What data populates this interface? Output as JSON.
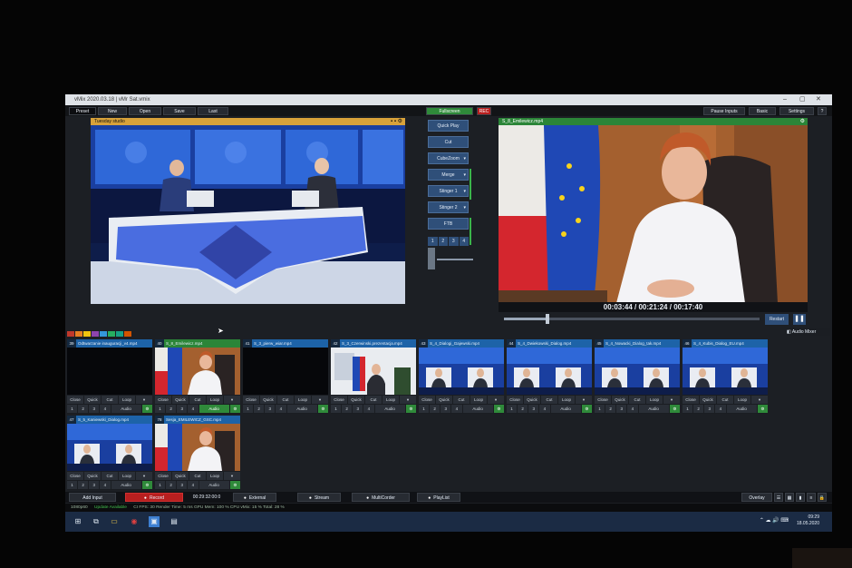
{
  "window": {
    "title": "vMix   2020.03.18 | vMr   Sat.vmix",
    "minimize": "–",
    "maximize": "▢",
    "close": "✕"
  },
  "menu": {
    "preset": "Preset",
    "new": "New",
    "open": "Open",
    "save": "Save",
    "last": "Last",
    "fullscreen": "Fullscreen",
    "rec": "REC",
    "pause_inputs": "Pause Inputs",
    "basic": "Basic",
    "settings": "Settings",
    "help": "?"
  },
  "preview": {
    "header": "Tuesday studio"
  },
  "program": {
    "header": "S_8_Emilewicz.mp4",
    "time_position": "00:03:44",
    "time_duration": "00:21:24",
    "time_remaining": "00:17:40",
    "progress": 0.17
  },
  "transitions": {
    "quick_play": "Quick Play",
    "cut": "Cut",
    "cube_zoom": "CubeZoom",
    "merge": "Merge",
    "stinger1": "Stinger 1",
    "stinger2": "Stinger 2",
    "ftb": "FTB",
    "numbers": [
      "1",
      "2",
      "3",
      "4"
    ]
  },
  "player": {
    "restart": "Restart",
    "pause": "❚❚",
    "audio_mixer": "Audio Mixer"
  },
  "colors": {
    "accent_blue": "#1d63a8",
    "preview_orange": "#d8a23a",
    "program_green": "#2b8538",
    "record_red": "#b81f1f",
    "color_chips": [
      "#c0392b",
      "#e67e22",
      "#f1c40f",
      "#8e44ad",
      "#3498db",
      "#27ae60",
      "#16a085",
      "#d35400"
    ]
  },
  "inputs": [
    {
      "num": "39",
      "name": "Odtwarzanie inauguracji_v4.mp4",
      "content": "dark"
    },
    {
      "num": "40",
      "name": "S_8_Emilewicz.mp4",
      "content": "woman"
    },
    {
      "num": "41",
      "name": "S_3_pierw_wiar.mp4",
      "content": "dark"
    },
    {
      "num": "42",
      "name": "S_3_Czerwinski.prezentacja.mp4",
      "content": "office"
    },
    {
      "num": "43",
      "name": "S_4_Dialogi_Gajewski.mp4",
      "content": "studio"
    },
    {
      "num": "44",
      "name": "S_4_Dwiekowski_Dialog.mp4",
      "content": "studio"
    },
    {
      "num": "45",
      "name": "S_4_Nowacki_Dialog_tak.mp4",
      "content": "studio"
    },
    {
      "num": "46",
      "name": "S_4_Kubis_Dialog_EU.mp4",
      "content": "studio"
    },
    {
      "num": "47",
      "name": "S_5_Kaniewski_Dialog.mp4",
      "content": "studio"
    },
    {
      "num": "78",
      "name": "Sesja_EMILEWICZ_GSC.mp4",
      "content": "woman"
    }
  ],
  "tile_controls": {
    "close": "Close",
    "quick_play": "Quick Play",
    "cut": "Cut",
    "loop": "Loop",
    "more": "▾",
    "n1": "1",
    "n2": "2",
    "n3": "3",
    "n4": "4",
    "audio": "Audio",
    "settings_icon": "⚙"
  },
  "bottom": {
    "add_input": "Add Input",
    "record": "Record",
    "record_time": "00:29:32:00:0",
    "external": "External",
    "stream": "Stream",
    "multicorder": "MultiCorder",
    "playlist": "PlayList",
    "overlay": "Overlay"
  },
  "status": {
    "resolution": "1080p60",
    "update": "Update Available",
    "rest": "CI  FPS: 30  Render Time: 5 ms  GPU Mem: 100 %  CPU vMix: 15 %  Total: 28 %"
  },
  "taskbar": {
    "time": "09:29",
    "date": "18.05.2020",
    "tray": "⌃ ☁ 🔊 ⌨"
  }
}
